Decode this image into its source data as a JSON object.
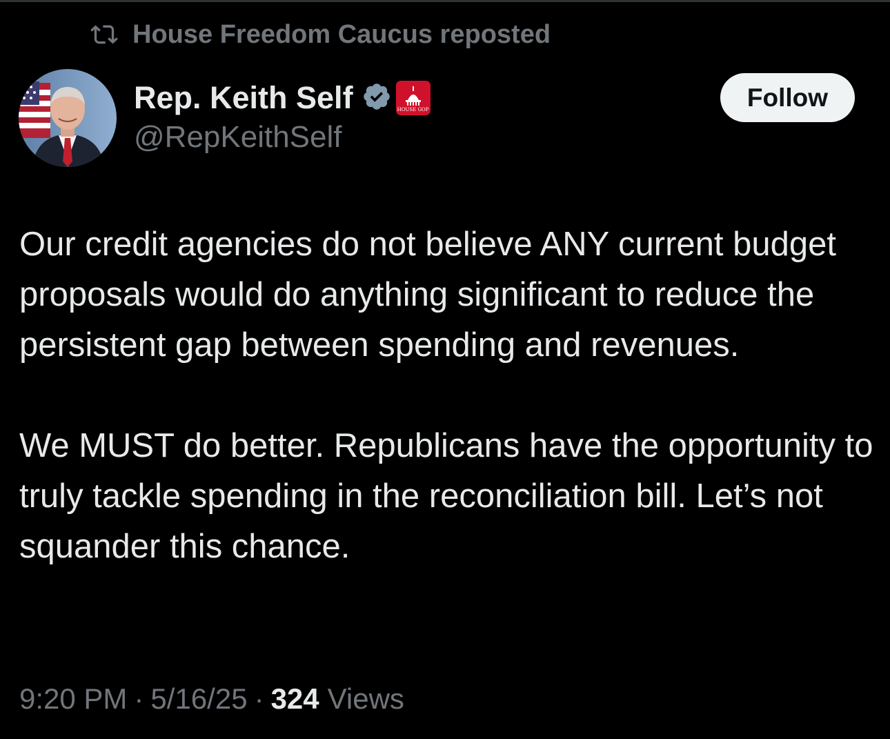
{
  "repost": {
    "icon": "repost-icon",
    "text": "House Freedom Caucus reposted"
  },
  "author": {
    "display_name": "Rep. Keith Self",
    "handle": "@RepKeithSelf",
    "verified_icon": "verified-badge-icon",
    "affiliation_badge": "house-gop-badge-icon",
    "affiliation_badge_text": "HOUSE GOP",
    "avatar": "avatar"
  },
  "follow_button": {
    "label": "Follow"
  },
  "tweet": {
    "paragraphs": [
      "Our credit agencies do not believe ANY current budget proposals would do anything significant to reduce the persistent gap between spending and revenues.",
      "We MUST do better. Republicans have the opportunity to truly tackle spending in the reconciliation bill. Let’s not squander this chance."
    ]
  },
  "meta": {
    "time": "9:20 PM",
    "separator": "·",
    "date": "5/16/25",
    "views_count": "324",
    "views_label": "Views"
  },
  "colors": {
    "background": "#000000",
    "text_primary": "#e7e9ea",
    "text_secondary": "#71767b",
    "verified_blue": "#829aab",
    "affiliation_red": "#d0112b",
    "follow_bg": "#eff3f4"
  }
}
